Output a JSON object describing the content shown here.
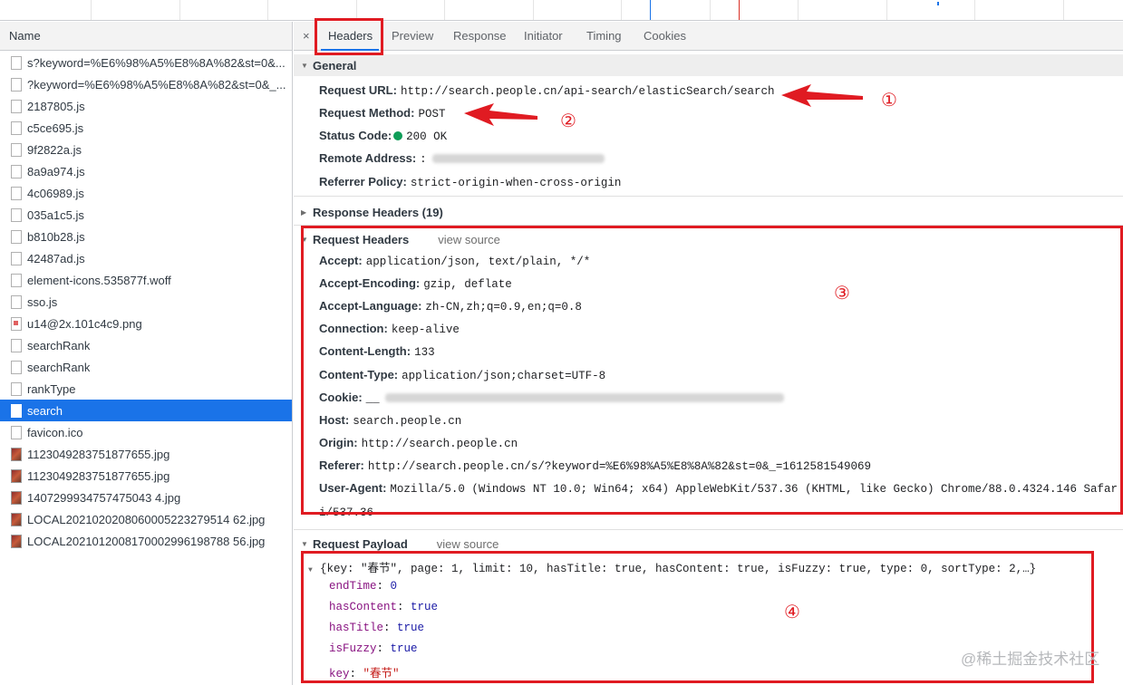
{
  "left_panel": {
    "column_header": "Name",
    "files": [
      {
        "name": "s?keyword=%E6%98%A5%E8%8A%82&st=0&...",
        "icon": "file-doc-icon",
        "selected": false
      },
      {
        "name": "?keyword=%E6%98%A5%E8%8A%82&st=0&_...",
        "icon": "file-doc-icon",
        "selected": false
      },
      {
        "name": "2187805.js",
        "icon": "file-doc-icon",
        "selected": false
      },
      {
        "name": "c5ce695.js",
        "icon": "file-doc-icon",
        "selected": false
      },
      {
        "name": "9f2822a.js",
        "icon": "file-doc-icon",
        "selected": false
      },
      {
        "name": "8a9a974.js",
        "icon": "file-doc-icon",
        "selected": false
      },
      {
        "name": "4c06989.js",
        "icon": "file-doc-icon",
        "selected": false
      },
      {
        "name": "035a1c5.js",
        "icon": "file-doc-icon",
        "selected": false
      },
      {
        "name": "b810b28.js",
        "icon": "file-doc-icon",
        "selected": false
      },
      {
        "name": "42487ad.js",
        "icon": "file-doc-icon",
        "selected": false
      },
      {
        "name": "element-icons.535877f.woff",
        "icon": "file-doc-icon",
        "selected": false
      },
      {
        "name": "sso.js",
        "icon": "file-doc-icon",
        "selected": false
      },
      {
        "name": "u14@2x.101c4c9.png",
        "icon": "file-png-icon",
        "selected": false
      },
      {
        "name": "searchRank",
        "icon": "file-doc-icon",
        "selected": false
      },
      {
        "name": "searchRank",
        "icon": "file-doc-icon",
        "selected": false
      },
      {
        "name": "rankType",
        "icon": "file-doc-icon",
        "selected": false
      },
      {
        "name": "search",
        "icon": "file-doc-icon",
        "selected": true
      },
      {
        "name": "favicon.ico",
        "icon": "file-doc-icon",
        "selected": false
      },
      {
        "name": "1123049283751877655.jpg",
        "icon": "file-image-icon",
        "selected": false
      },
      {
        "name": "1123049283751877655.jpg",
        "icon": "file-image-icon",
        "selected": false
      },
      {
        "name": "1407299934757475043 4.jpg",
        "icon": "file-image-icon",
        "selected": false
      },
      {
        "name": "LOCAL2021020208060005223279514 62.jpg",
        "icon": "file-image-icon",
        "selected": false
      },
      {
        "name": "LOCAL2021012008170002996198788 56.jpg",
        "icon": "file-image-icon",
        "selected": false
      }
    ]
  },
  "tabs": {
    "close": "×",
    "items": [
      "Headers",
      "Preview",
      "Response",
      "Initiator",
      "Timing",
      "Cookies"
    ],
    "active": "Headers"
  },
  "general": {
    "title": "General",
    "rows": [
      {
        "key": "Request URL:",
        "value": "http://search.people.cn/api-search/elasticSearch/search"
      },
      {
        "key": "Request Method:",
        "value": "POST"
      },
      {
        "key": "Status Code:",
        "value": "200 OK"
      },
      {
        "key": "Remote Address:",
        "value": ":"
      },
      {
        "key": "Referrer Policy:",
        "value": "strict-origin-when-cross-origin"
      }
    ]
  },
  "response_headers": {
    "title": "Response Headers (19)"
  },
  "request_headers": {
    "title": "Request Headers",
    "view_source": "view source",
    "rows": [
      {
        "key": "Accept:",
        "value": "application/json, text/plain, */*"
      },
      {
        "key": "Accept-Encoding:",
        "value": "gzip, deflate"
      },
      {
        "key": "Accept-Language:",
        "value": "zh-CN,zh;q=0.9,en;q=0.8"
      },
      {
        "key": "Connection:",
        "value": "keep-alive"
      },
      {
        "key": "Content-Length:",
        "value": "133"
      },
      {
        "key": "Content-Type:",
        "value": "application/json;charset=UTF-8"
      },
      {
        "key": "Cookie:",
        "value": "__"
      },
      {
        "key": "Host:",
        "value": "search.people.cn"
      },
      {
        "key": "Origin:",
        "value": "http://search.people.cn"
      },
      {
        "key": "Referer:",
        "value": "http://search.people.cn/s/?keyword=%E6%98%A5%E8%8A%82&st=0&_=1612581549069"
      },
      {
        "key": "User-Agent:",
        "value": "Mozilla/5.0 (Windows NT 10.0; Win64; x64) AppleWebKit/537.36 (KHTML, like Gecko) Chrome/88.0.4324.146 Safar"
      }
    ],
    "user_agent_wrap": "i/537.36"
  },
  "request_payload": {
    "title": "Request Payload",
    "view_source": "view source",
    "summary": "{key: \"春节\", page: 1, limit: 10, hasTitle: true, hasContent: true, isFuzzy: true, type: 0, sortType: 2,…}",
    "fields": [
      {
        "key": "endTime",
        "value": "0",
        "kind": "num"
      },
      {
        "key": "hasContent",
        "value": "true",
        "kind": "num"
      },
      {
        "key": "hasTitle",
        "value": "true",
        "kind": "num"
      },
      {
        "key": "isFuzzy",
        "value": "true",
        "kind": "num"
      },
      {
        "key": "key",
        "value": "\"春节\"",
        "kind": "str"
      }
    ]
  },
  "annotations": {
    "markers": [
      "①",
      "②",
      "③",
      "④"
    ],
    "color": "#e01b22"
  },
  "watermark": "@稀土掘金技术社区"
}
